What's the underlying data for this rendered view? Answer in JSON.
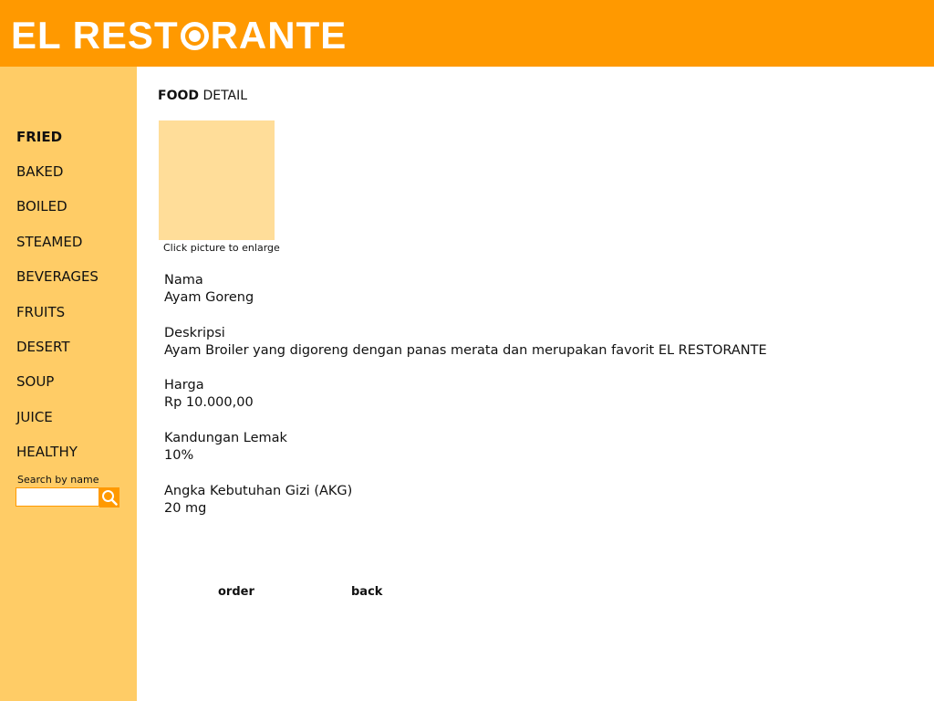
{
  "header": {
    "logo_before": "EL REST",
    "logo_after": "RANTE",
    "background": "#ff9900"
  },
  "sidebar": {
    "background": "#ffcc66",
    "items": [
      {
        "label": "FRIED",
        "active": true
      },
      {
        "label": "BAKED",
        "active": false
      },
      {
        "label": "BOILED",
        "active": false
      },
      {
        "label": "STEAMED",
        "active": false
      },
      {
        "label": "BEVERAGES",
        "active": false
      },
      {
        "label": "FRUITS",
        "active": false
      },
      {
        "label": "DESERT",
        "active": false
      },
      {
        "label": "SOUP",
        "active": false
      },
      {
        "label": "JUICE",
        "active": false
      },
      {
        "label": "HEALTHY",
        "active": false
      }
    ],
    "search": {
      "label": "Search by name",
      "value": "",
      "placeholder": "",
      "button_icon": "search-icon"
    }
  },
  "main": {
    "title_bold": "FOOD",
    "title_rest": " DETAIL",
    "image_placeholder_color": "#ffdd99",
    "image_caption": "Click picture to enlarge",
    "fields": [
      {
        "label": "Nama",
        "value": "Ayam Goreng"
      },
      {
        "label": "Deskripsi",
        "value": "Ayam Broiler yang digoreng dengan panas merata dan merupakan favorit EL RESTORANTE"
      },
      {
        "label": "Harga",
        "value": "Rp 10.000,00"
      },
      {
        "label": "Kandungan Lemak",
        "value": "10%"
      },
      {
        "label": "Angka Kebutuhan Gizi (AKG)",
        "value": "20 mg"
      }
    ],
    "actions": {
      "order": "order",
      "back": "back"
    }
  }
}
